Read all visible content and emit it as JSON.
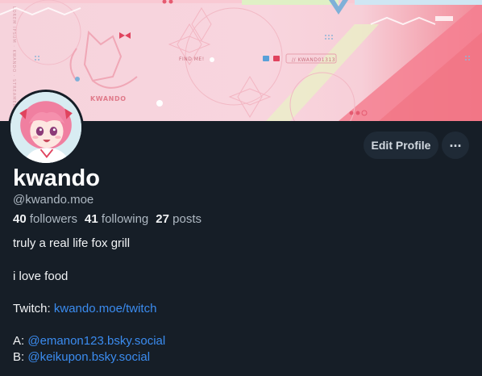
{
  "banner": {
    "find_me_label": "FIND ME!",
    "banner_handle": "// KWAND01313",
    "logo_text": "KWANDO",
    "vertical_text": "LOREM IPSUM · KWANDO · STREAMER"
  },
  "profile": {
    "display_name": "kwando",
    "handle": "@kwando.moe",
    "followers_count": "40",
    "followers_label": "followers",
    "following_count": "41",
    "following_label": "following",
    "posts_count": "27",
    "posts_label": "posts"
  },
  "actions": {
    "edit_profile_label": "Edit Profile",
    "more_label": "..."
  },
  "bio": {
    "line1": "truly a real life fox grill",
    "line2": "i love food",
    "twitch_prefix": "Twitch: ",
    "twitch_link": "kwando.moe/twitch",
    "a_prefix": "A: ",
    "a_link": "@emanon123.bsky.social",
    "b_prefix": "B: ",
    "b_link": "@keikupon.bsky.social"
  },
  "colors": {
    "background": "#161e27",
    "link": "#3b8cf0",
    "button_bg": "#1f2a36",
    "banner_pink": "#f6d3dc",
    "banner_accent": "#f28a98"
  }
}
